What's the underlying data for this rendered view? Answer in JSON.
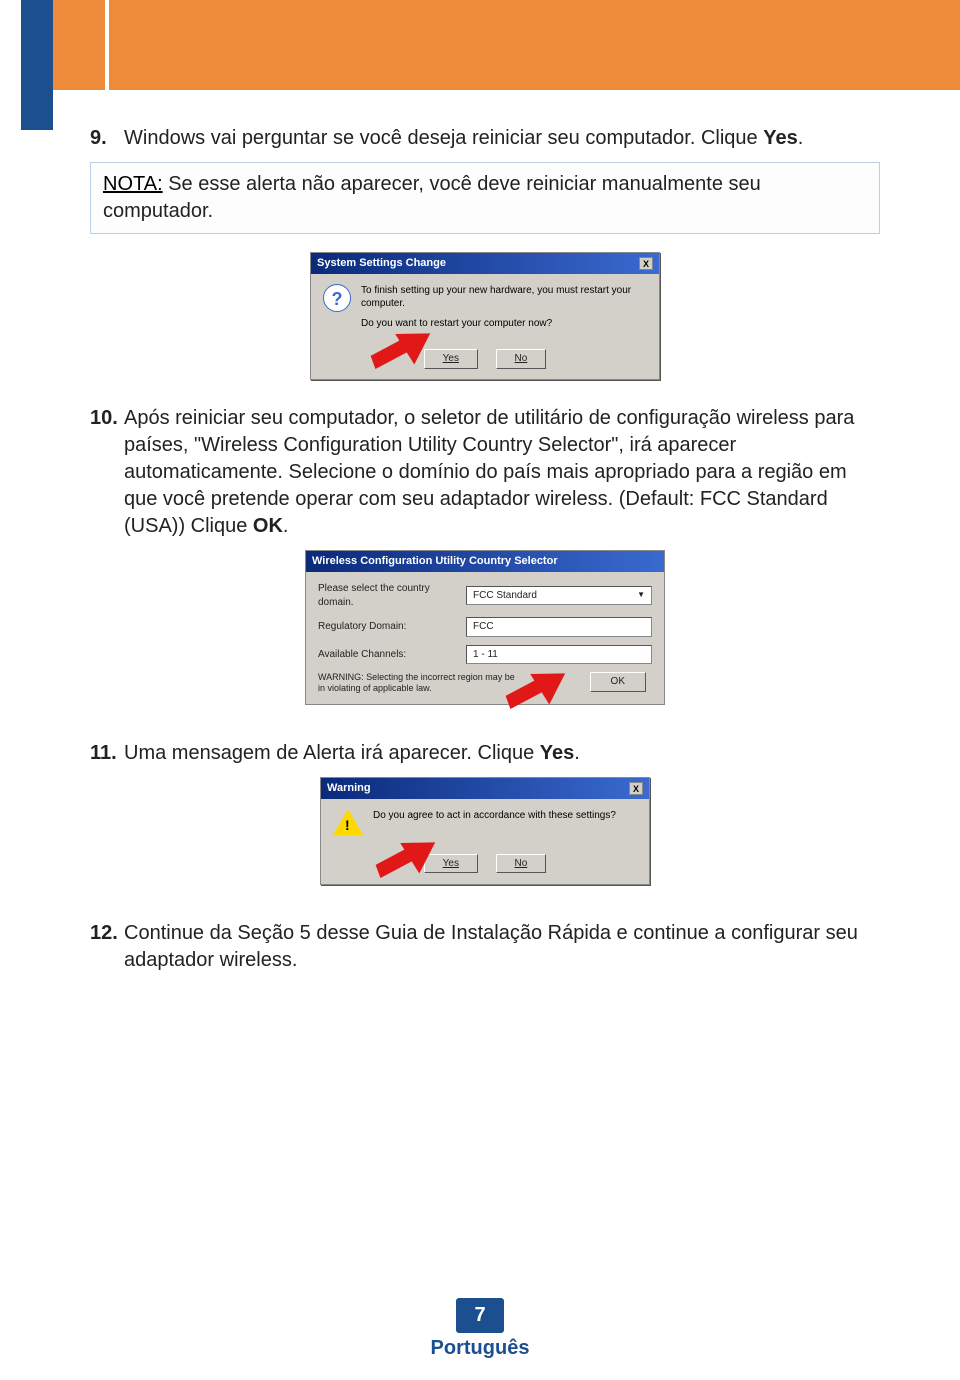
{
  "header": {},
  "steps": {
    "s9": {
      "num": "9.",
      "text_a": "Windows vai perguntar se você deseja reiniciar seu computador. Clique ",
      "text_b": "Yes",
      "text_c": "."
    },
    "note": {
      "label": "NOTA:",
      "text": " Se esse alerta não aparecer, você deve reiniciar manualmente seu computador."
    },
    "s10": {
      "num": "10.",
      "text_a": "Após reiniciar seu computador, o seletor de utilitário de configuração wireless para países, \"Wireless Configuration Utility Country Selector\", irá aparecer automaticamente. Selecione o domínio do país mais apropriado para a região em que você pretende operar com seu adaptador wireless. (Default: FCC Standard (USA)) Clique ",
      "text_b": "OK",
      "text_c": "."
    },
    "s11": {
      "num": "11.",
      "text_a": "Uma mensagem de Alerta irá aparecer. Clique ",
      "text_b": "Yes",
      "text_c": "."
    },
    "s12": {
      "num": "12.",
      "text_a": "Continue da Seção 5 desse Guia de Instalação Rápida e continue a configurar seu adaptador wireless."
    }
  },
  "dialog1": {
    "title": "System Settings Change",
    "line1": "To finish setting up your new hardware, you must restart your computer.",
    "line2": "Do you want to restart your computer now?",
    "yes": "Yes",
    "no": "No",
    "close": "X"
  },
  "dialog2": {
    "title": "Wireless Configuration Utility Country Selector",
    "label_country": "Please select the country domain.",
    "value_country": "FCC Standard",
    "label_reg": "Regulatory Domain:",
    "value_reg": "FCC",
    "label_ch": "Available Channels:",
    "value_ch": "1 - 11",
    "warn": "WARNING: Selecting the incorrect region may be in violating of applicable law.",
    "ok": "OK"
  },
  "dialog3": {
    "title": "Warning",
    "line1": "Do you agree to act in accordance with these settings?",
    "yes": "Yes",
    "no": "No",
    "close": "X"
  },
  "footer": {
    "page": "7",
    "lang": "Português"
  }
}
